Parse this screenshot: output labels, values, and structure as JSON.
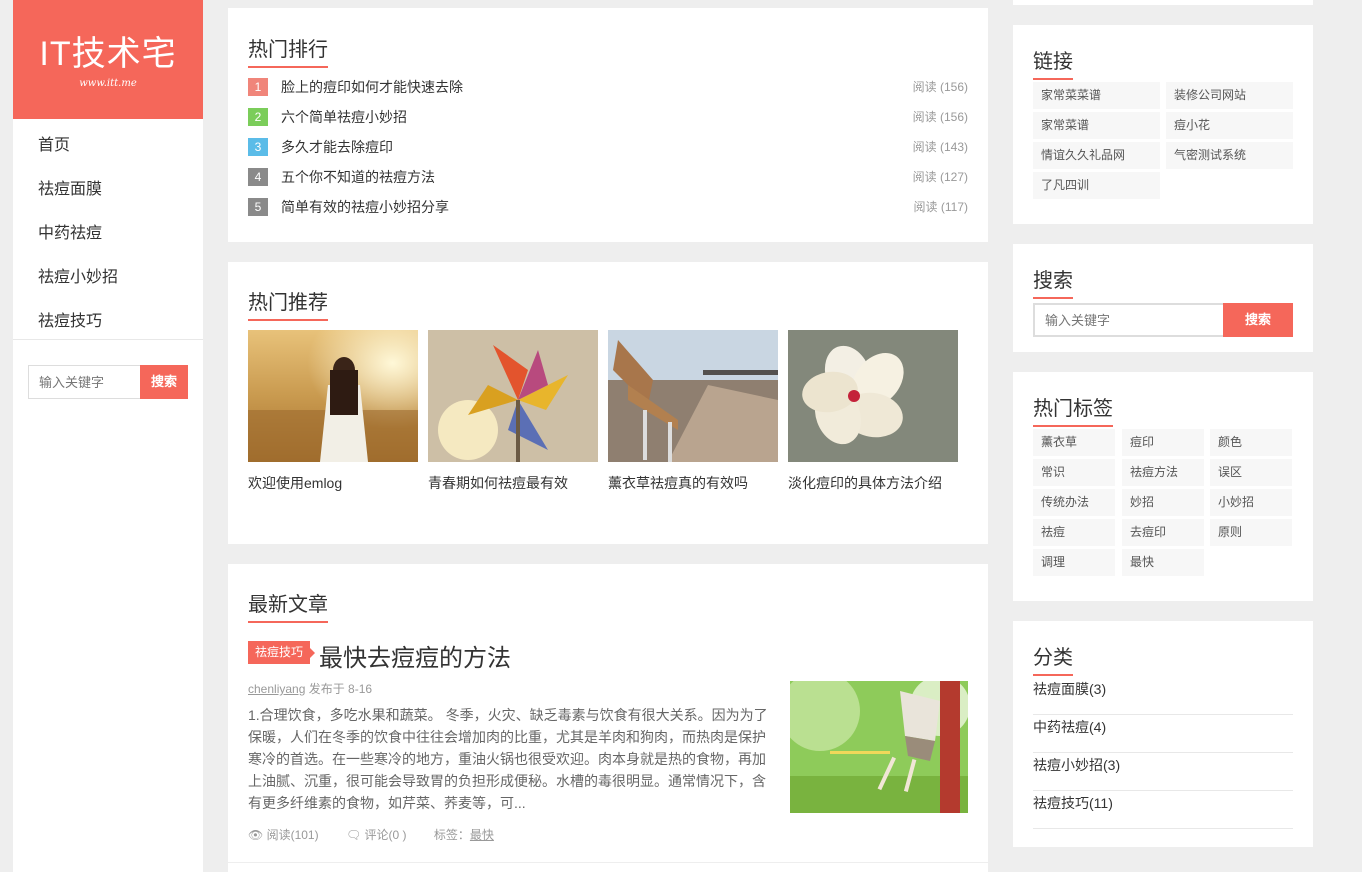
{
  "site": {
    "title": "IT技术宅",
    "url": "www.itt.me"
  },
  "nav": [
    {
      "label": "首页"
    },
    {
      "label": "祛痘面膜"
    },
    {
      "label": "中药祛痘"
    },
    {
      "label": "祛痘小妙招"
    },
    {
      "label": "祛痘技巧"
    }
  ],
  "left_search": {
    "placeholder": "输入关键字",
    "button": "搜索"
  },
  "hot_rank": {
    "title": "热门排行",
    "items": [
      {
        "num": "1",
        "title": "脸上的痘印如何才能快速去除",
        "views": "阅读 (156)",
        "color": "#f0857a"
      },
      {
        "num": "2",
        "title": "六个简单祛痘小妙招",
        "views": "阅读 (156)",
        "color": "#7bcd5a"
      },
      {
        "num": "3",
        "title": "多久才能去除痘印",
        "views": "阅读 (143)",
        "color": "#5bbce8"
      },
      {
        "num": "4",
        "title": "五个你不知道的祛痘方法",
        "views": "阅读 (127)",
        "color": "#8a8a8a"
      },
      {
        "num": "5",
        "title": "简单有效的祛痘小妙招分享",
        "views": "阅读 (117)",
        "color": "#8a8a8a"
      }
    ]
  },
  "hot_recommend": {
    "title": "热门推荐",
    "items": [
      {
        "caption": "欢迎使用emlog"
      },
      {
        "caption": "青春期如何祛痘最有效"
      },
      {
        "caption": "薰衣草祛痘真的有效吗"
      },
      {
        "caption": "淡化痘印的具体方法介绍"
      }
    ]
  },
  "latest": {
    "title": "最新文章",
    "article": {
      "category": "祛痘技巧",
      "title": "最快去痘痘的方法",
      "author": "chenliyang",
      "published": "发布于 8-16",
      "excerpt": "1.合理饮食，多吃水果和蔬菜。 冬季，火灾、缺乏毒素与饮食有很大关系。因为为了保暖，人们在冬季的饮食中往往会增加肉的比重，尤其是羊肉和狗肉，而热肉是保护寒冷的首选。在一些寒冷的地方，重油火锅也很受欢迎。肉本身就是热的食物，再加上油腻、沉重，很可能会导致胃的负担形成便秘。水槽的毒很明显。通常情况下，含有更多纤维素的食物，如芹菜、荞麦等，可...",
      "reads": "阅读(101)",
      "comments": "评论(0 )",
      "tags_label": "标签：",
      "tag": "最快"
    }
  },
  "links": {
    "title": "链接",
    "items": [
      "家常菜菜谱",
      "装修公司网站",
      "家常菜谱",
      "痘小花",
      "情谊久久礼品网",
      "气密测试系统",
      "了凡四训"
    ]
  },
  "right_search": {
    "title": "搜索",
    "placeholder": "输入关键字",
    "button": "搜索"
  },
  "hot_tags": {
    "title": "热门标签",
    "items": [
      "薰衣草",
      "痘印",
      "颜色",
      "常识",
      "祛痘方法",
      "误区",
      "传统办法",
      "妙招",
      "小妙招",
      "祛痘",
      "去痘印",
      "原则",
      "调理",
      "最快"
    ]
  },
  "categories": {
    "title": "分类",
    "items": [
      "祛痘面膜(3)",
      "中药祛痘(4)",
      "祛痘小妙招(3)",
      "祛痘技巧(11)"
    ]
  },
  "colors": {
    "accent": "#f5675a",
    "background": "#eeeeee"
  }
}
